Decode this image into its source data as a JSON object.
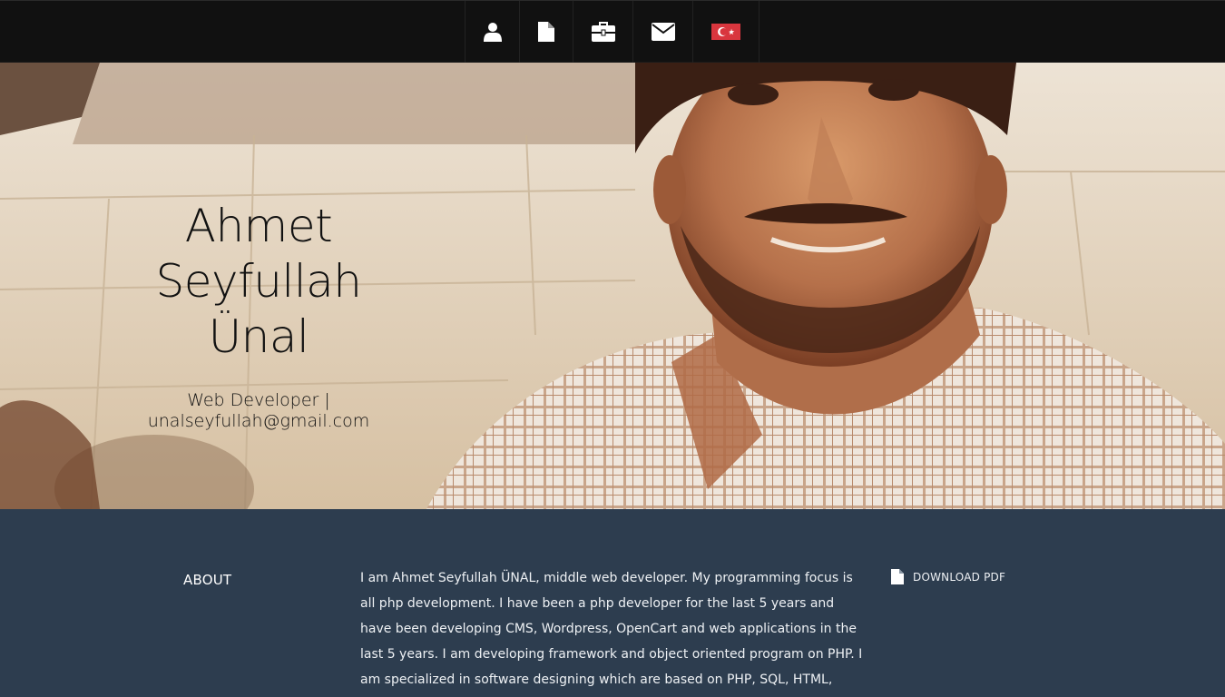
{
  "nav": {
    "items": [
      {
        "icon": "user-icon"
      },
      {
        "icon": "document-icon"
      },
      {
        "icon": "briefcase-icon"
      },
      {
        "icon": "envelope-icon"
      },
      {
        "icon": "turkey-flag-icon"
      }
    ]
  },
  "hero": {
    "name_line1": "Ahmet",
    "name_line2": "Seyfullah",
    "name_line3": "Ünal",
    "subtitle_line1": "Web Developer |",
    "subtitle_line2": "unalseyfullah@gmail.com"
  },
  "about": {
    "title": "ABOUT",
    "text": "I am Ahmet Seyfullah ÜNAL, middle web developer. My programming focus is all php development. I have been a php developer for the last 5 years and have been developing CMS, Wordpress, OpenCart and web applications in the last 5 years. I am developing framework and object oriented program on PHP. I am specialized in software designing which are based on PHP, SQL, HTML, CSS, Javascript",
    "download_label": "DOWNLOAD PDF"
  },
  "colors": {
    "nav_bg": "#111111",
    "about_bg": "#2d3d4f",
    "flag_red": "#d9363e"
  }
}
